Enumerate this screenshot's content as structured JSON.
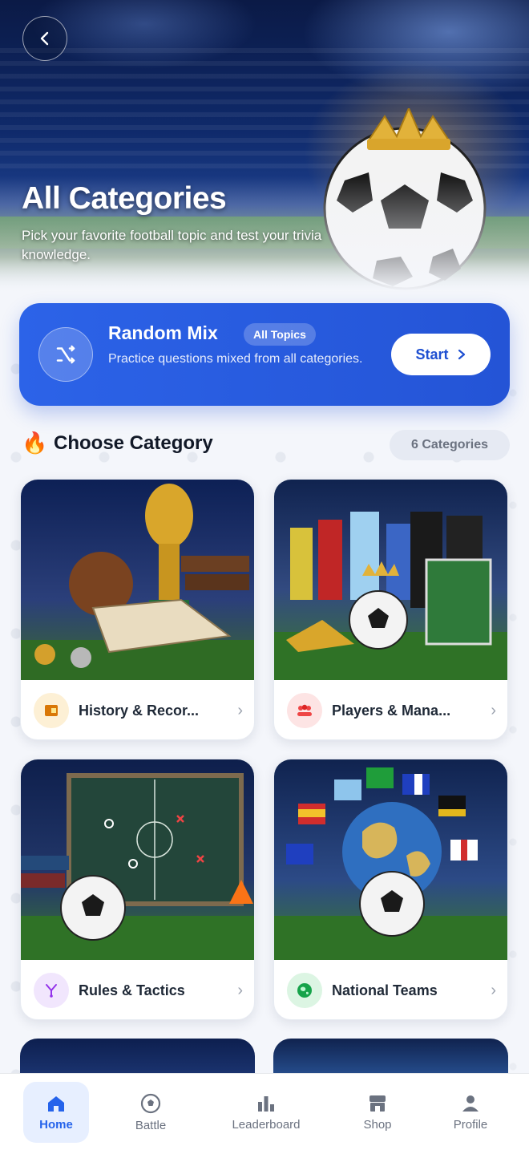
{
  "header": {
    "back_label": "‹",
    "title": "All Categories",
    "subtitle": "Pick your favorite football topic and test your trivia knowledge."
  },
  "random_mix": {
    "title": "Random Mix",
    "badge": "All Topics",
    "description": "Practice questions mixed from all categories.",
    "start_label": "Start",
    "icon": "shuffle-icon"
  },
  "section": {
    "icon": "🔥",
    "title": "Choose Category",
    "count_label": "6 Categories"
  },
  "categories": [
    {
      "label": "History & Recor...",
      "icon": "book-icon",
      "chevron": "›"
    },
    {
      "label": "Players & Mana...",
      "icon": "team-icon",
      "chevron": "›"
    },
    {
      "label": "Rules & Tactics",
      "icon": "tactics-icon",
      "chevron": "›"
    },
    {
      "label": "National Teams",
      "icon": "globe-icon",
      "chevron": "›"
    }
  ],
  "nav": {
    "items": [
      {
        "label": "Home",
        "icon": "home-icon",
        "active": true
      },
      {
        "label": "Battle",
        "icon": "ball-icon",
        "active": false
      },
      {
        "label": "Leaderboard",
        "icon": "chart-icon",
        "active": false
      },
      {
        "label": "Shop",
        "icon": "shop-icon",
        "active": false
      },
      {
        "label": "Profile",
        "icon": "user-icon",
        "active": false
      }
    ]
  },
  "colors": {
    "accent": "#2454d6",
    "active_nav": "#2563eb",
    "background": "#f4f6fb"
  }
}
